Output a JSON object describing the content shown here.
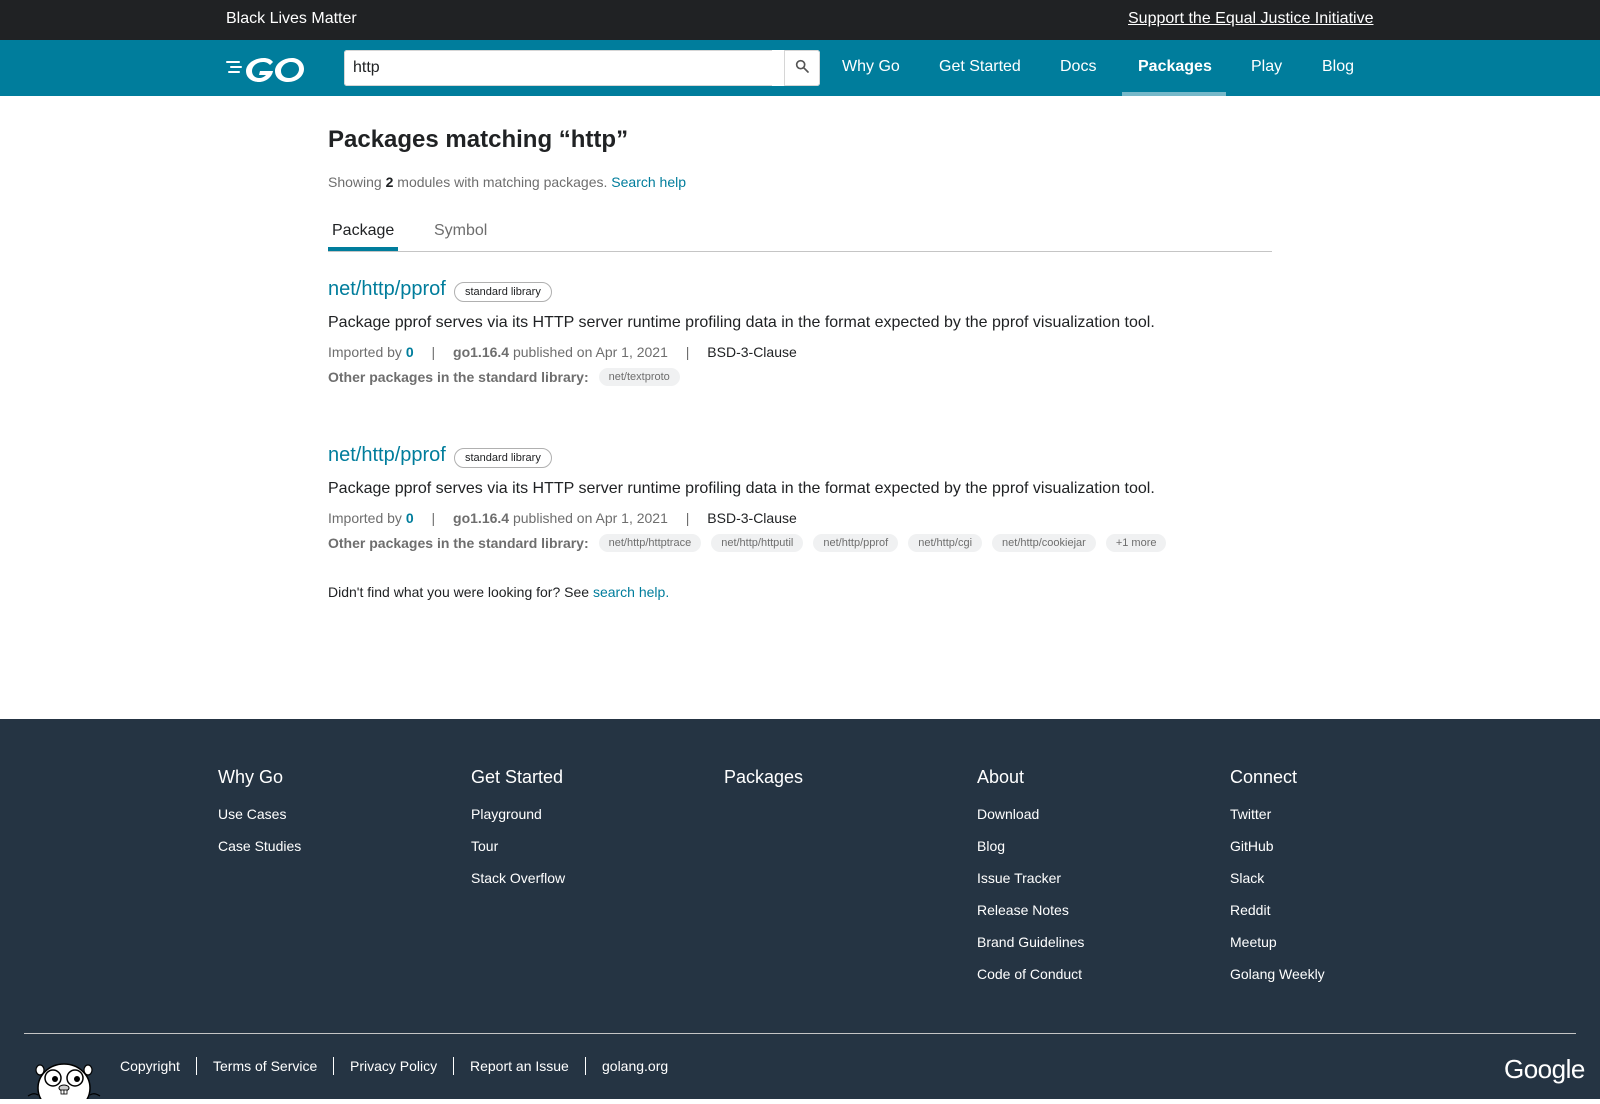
{
  "banner": {
    "left": "Black Lives Matter",
    "right": "Support the Equal Justice Initiative"
  },
  "header": {
    "logo_alt": "Go",
    "search_value": "http",
    "nav": [
      "Why Go",
      "Get Started",
      "Docs",
      "Packages",
      "Play",
      "Blog"
    ],
    "active_nav": "Packages"
  },
  "main": {
    "title": "Packages matching “http”",
    "showing_prefix": "Showing",
    "showing_count": "2",
    "showing_suffix": "modules with matching packages.",
    "search_help": "Search help",
    "tabs": [
      "Package",
      "Symbol"
    ],
    "results": [
      {
        "title": "net/http/pprof",
        "badge": "standard library",
        "synopsis": "Package pprof serves via its HTTP server runtime profiling data in the format expected by the pprof visualization tool.",
        "imported_by_label": "Imported by",
        "imported_by": "0",
        "version": "go1.16.4",
        "published": "published on Apr 1, 2021",
        "license": "BSD-3-Clause",
        "others_label": "Other packages in the standard library:",
        "others": [
          "net/textproto"
        ]
      },
      {
        "title": "net/http/pprof",
        "badge": "standard library",
        "synopsis": "Package pprof serves via its HTTP server runtime profiling data in the format expected by the pprof visualization tool.",
        "imported_by_label": "Imported by",
        "imported_by": "0",
        "version": "go1.16.4",
        "published": "published on Apr 1, 2021",
        "license": "BSD-3-Clause",
        "others_label": "Other packages in the standard library:",
        "others": [
          "net/http/httptrace",
          "net/http/httputil",
          "net/http/pprof",
          "net/http/cgi",
          "net/http/cookiejar",
          "+1 more"
        ]
      }
    ],
    "notfound_text": "Didn't find what you were looking for? See",
    "notfound_link": "search help."
  },
  "footer": {
    "columns": [
      {
        "heading": "Why Go",
        "links": [
          "Use Cases",
          "Case Studies"
        ]
      },
      {
        "heading": "Get Started",
        "links": [
          "Playground",
          "Tour",
          "Stack Overflow"
        ]
      },
      {
        "heading": "Packages",
        "links": []
      },
      {
        "heading": "About",
        "links": [
          "Download",
          "Blog",
          "Issue Tracker",
          "Release Notes",
          "Brand Guidelines",
          "Code of Conduct"
        ]
      },
      {
        "heading": "Connect",
        "links": [
          "Twitter",
          "GitHub",
          "Slack",
          "Reddit",
          "Meetup",
          "Golang Weekly"
        ]
      }
    ],
    "bottom_links": [
      "Copyright",
      "Terms of Service",
      "Privacy Policy",
      "Report an Issue",
      "golang.org"
    ],
    "google": "Google"
  },
  "colors": {
    "brand": "#007d9c",
    "footer_bg": "#253443",
    "banner_bg": "#202224"
  },
  "icons": {
    "search": "search-icon",
    "gopher": "gopher-icon",
    "google": "google-logo"
  }
}
